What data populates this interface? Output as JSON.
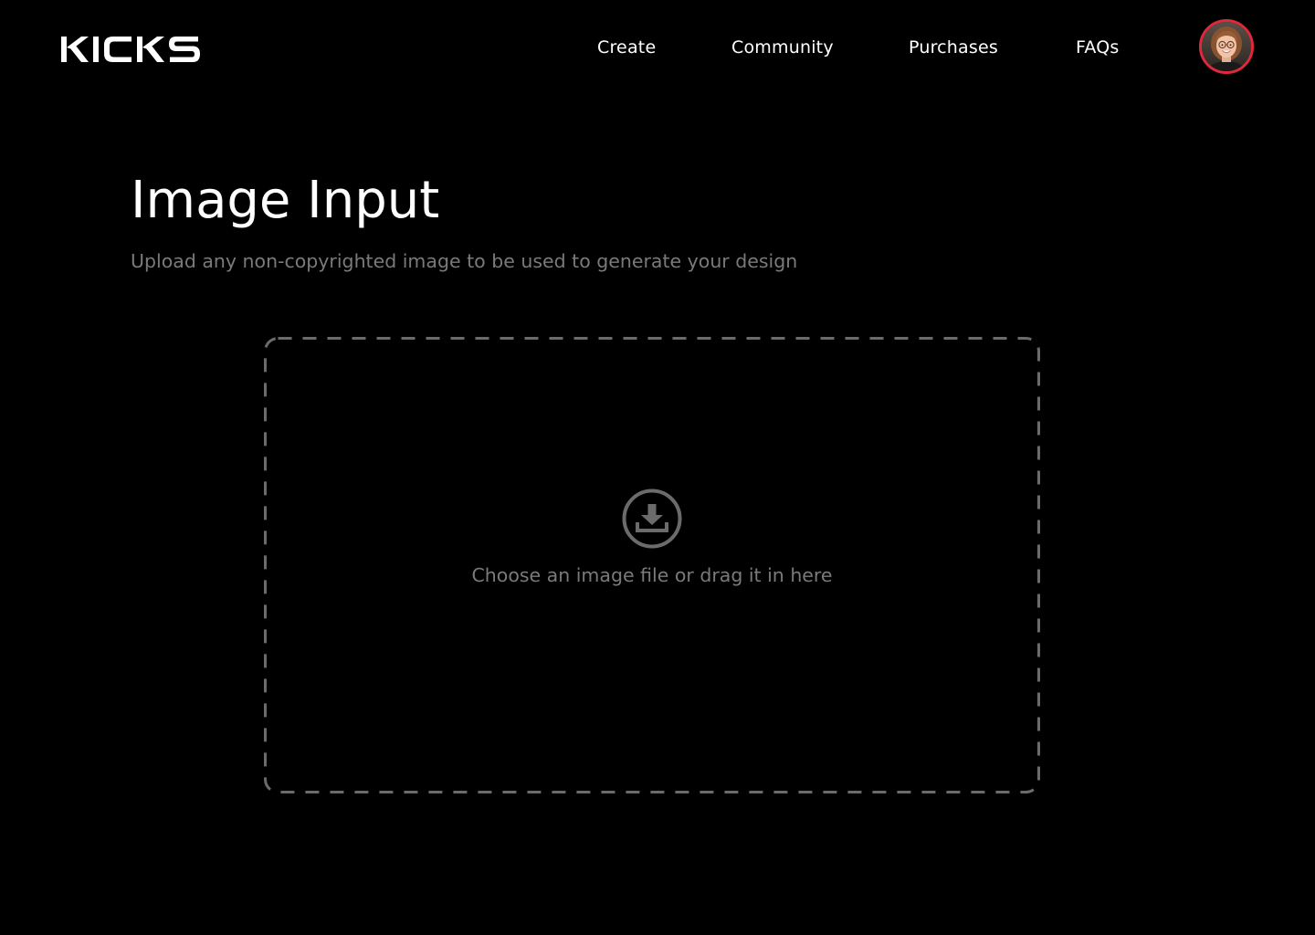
{
  "header": {
    "logo_text": "KICKS",
    "nav": [
      {
        "label": "Create"
      },
      {
        "label": "Community"
      },
      {
        "label": "Purchases"
      },
      {
        "label": "FAQs"
      }
    ],
    "avatar_alt": "User profile"
  },
  "main": {
    "title": "Image Input",
    "subtitle": "Upload any non-copyrighted image to be used to generate your design",
    "dropzone": {
      "icon": "upload-icon",
      "text": "Choose an image file or drag it in here"
    }
  },
  "colors": {
    "background": "#000000",
    "text": "#ffffff",
    "muted_text": "#7a7a7a",
    "dash_border": "#6b6b6b",
    "avatar_ring": "#e0283c"
  }
}
